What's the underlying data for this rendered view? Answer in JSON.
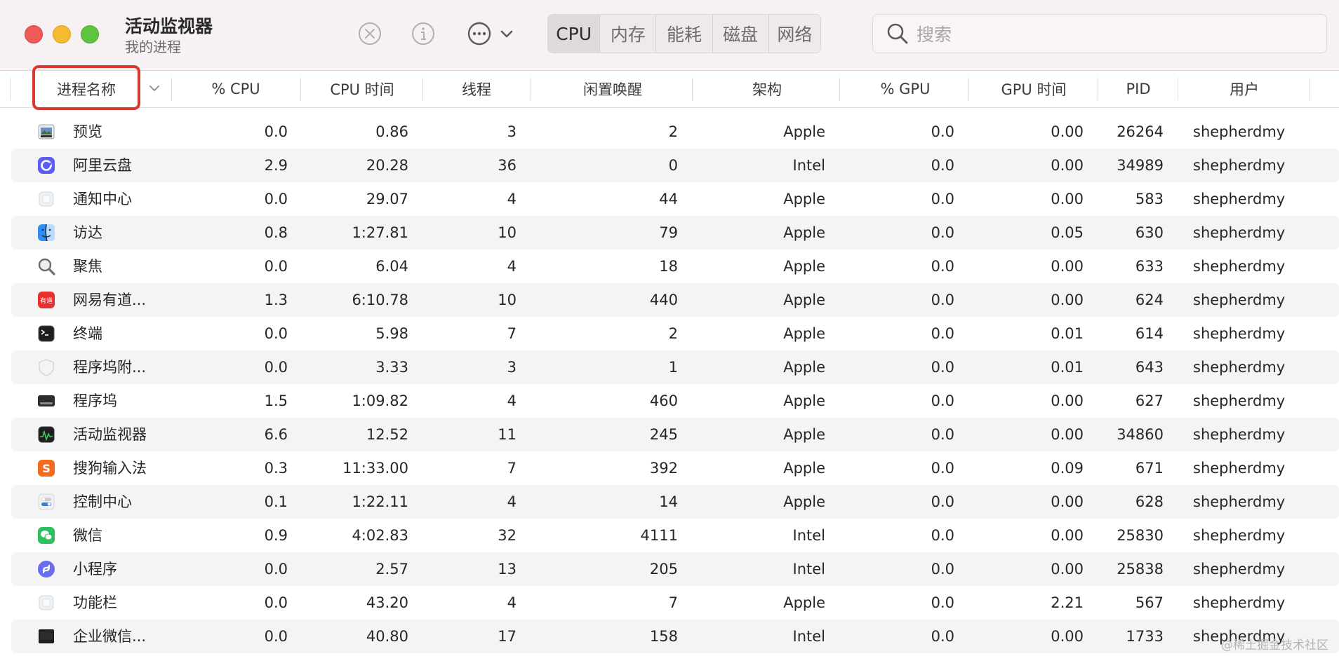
{
  "window": {
    "title": "活动监视器",
    "subtitle": "我的进程"
  },
  "toolbar": {
    "icons": [
      "stop-process-icon",
      "info-icon",
      "more-actions-icon",
      "chevron-down-icon"
    ],
    "tabs": [
      {
        "label": "CPU",
        "active": true
      },
      {
        "label": "内存",
        "active": false
      },
      {
        "label": "能耗",
        "active": false
      },
      {
        "label": "磁盘",
        "active": false
      },
      {
        "label": "网络",
        "active": false
      }
    ],
    "search": {
      "placeholder": "搜索",
      "value": ""
    }
  },
  "columns": [
    "进程名称",
    "% CPU",
    "CPU 时间",
    "线程",
    "闲置唤醒",
    "架构",
    "% GPU",
    "GPU 时间",
    "PID",
    "用户"
  ],
  "rows": [
    {
      "icon": "preview-icon",
      "name": "预览",
      "cpu": "0.0",
      "cpu_time": "0.86",
      "threads": "3",
      "idle_wakeups": "2",
      "arch": "Apple",
      "gpu": "0.0",
      "gpu_time": "0.00",
      "pid": "26264",
      "user": "shepherdmy"
    },
    {
      "icon": "aliyun-drive-icon",
      "name": "阿里云盘",
      "cpu": "2.9",
      "cpu_time": "20.28",
      "threads": "36",
      "idle_wakeups": "0",
      "arch": "Intel",
      "gpu": "0.0",
      "gpu_time": "0.00",
      "pid": "34989",
      "user": "shepherdmy"
    },
    {
      "icon": "generic-app-icon",
      "name": "通知中心",
      "cpu": "0.0",
      "cpu_time": "29.07",
      "threads": "4",
      "idle_wakeups": "44",
      "arch": "Apple",
      "gpu": "0.0",
      "gpu_time": "0.00",
      "pid": "583",
      "user": "shepherdmy"
    },
    {
      "icon": "finder-icon",
      "name": "访达",
      "cpu": "0.8",
      "cpu_time": "1:27.81",
      "threads": "10",
      "idle_wakeups": "79",
      "arch": "Apple",
      "gpu": "0.0",
      "gpu_time": "0.05",
      "pid": "630",
      "user": "shepherdmy"
    },
    {
      "icon": "spotlight-icon",
      "name": "聚焦",
      "cpu": "0.0",
      "cpu_time": "6.04",
      "threads": "4",
      "idle_wakeups": "18",
      "arch": "Apple",
      "gpu": "0.0",
      "gpu_time": "0.00",
      "pid": "633",
      "user": "shepherdmy"
    },
    {
      "icon": "youdao-icon",
      "name": "网易有道...",
      "cpu": "1.3",
      "cpu_time": "6:10.78",
      "threads": "10",
      "idle_wakeups": "440",
      "arch": "Apple",
      "gpu": "0.0",
      "gpu_time": "0.00",
      "pid": "624",
      "user": "shepherdmy"
    },
    {
      "icon": "terminal-icon",
      "name": "终端",
      "cpu": "0.0",
      "cpu_time": "5.98",
      "threads": "7",
      "idle_wakeups": "2",
      "arch": "Apple",
      "gpu": "0.0",
      "gpu_time": "0.01",
      "pid": "614",
      "user": "shepherdmy"
    },
    {
      "icon": "shield-icon",
      "name": "程序坞附...",
      "cpu": "0.0",
      "cpu_time": "3.33",
      "threads": "3",
      "idle_wakeups": "1",
      "arch": "Apple",
      "gpu": "0.0",
      "gpu_time": "0.01",
      "pid": "643",
      "user": "shepherdmy"
    },
    {
      "icon": "dock-icon",
      "name": "程序坞",
      "cpu": "1.5",
      "cpu_time": "1:09.82",
      "threads": "4",
      "idle_wakeups": "460",
      "arch": "Apple",
      "gpu": "0.0",
      "gpu_time": "0.00",
      "pid": "627",
      "user": "shepherdmy"
    },
    {
      "icon": "activity-monitor-icon",
      "name": "活动监视器",
      "cpu": "6.6",
      "cpu_time": "12.52",
      "threads": "11",
      "idle_wakeups": "245",
      "arch": "Apple",
      "gpu": "0.0",
      "gpu_time": "0.00",
      "pid": "34860",
      "user": "shepherdmy"
    },
    {
      "icon": "sogou-input-icon",
      "name": "搜狗输入法",
      "cpu": "0.3",
      "cpu_time": "11:33.00",
      "threads": "7",
      "idle_wakeups": "392",
      "arch": "Apple",
      "gpu": "0.0",
      "gpu_time": "0.09",
      "pid": "671",
      "user": "shepherdmy"
    },
    {
      "icon": "control-center-icon",
      "name": "控制中心",
      "cpu": "0.1",
      "cpu_time": "1:22.11",
      "threads": "4",
      "idle_wakeups": "14",
      "arch": "Apple",
      "gpu": "0.0",
      "gpu_time": "0.00",
      "pid": "628",
      "user": "shepherdmy"
    },
    {
      "icon": "wechat-icon",
      "name": "微信",
      "cpu": "0.9",
      "cpu_time": "4:02.83",
      "threads": "32",
      "idle_wakeups": "4111",
      "arch": "Intel",
      "gpu": "0.0",
      "gpu_time": "0.00",
      "pid": "25830",
      "user": "shepherdmy"
    },
    {
      "icon": "mini-program-icon",
      "name": "小程序",
      "cpu": "0.0",
      "cpu_time": "2.57",
      "threads": "13",
      "idle_wakeups": "205",
      "arch": "Intel",
      "gpu": "0.0",
      "gpu_time": "0.00",
      "pid": "25838",
      "user": "shepherdmy"
    },
    {
      "icon": "generic-app-icon",
      "name": "功能栏",
      "cpu": "0.0",
      "cpu_time": "43.20",
      "threads": "4",
      "idle_wakeups": "7",
      "arch": "Apple",
      "gpu": "0.0",
      "gpu_time": "2.21",
      "pid": "567",
      "user": "shepherdmy"
    },
    {
      "icon": "wecom-icon",
      "name": "企业微信...",
      "cpu": "0.0",
      "cpu_time": "40.80",
      "threads": "17",
      "idle_wakeups": "158",
      "arch": "Intel",
      "gpu": "0.0",
      "gpu_time": "0.00",
      "pid": "1733",
      "user": "shepherdmy"
    }
  ],
  "watermark": "@稀土掘金技术社区",
  "colors": {
    "highlight": "#d83a2e",
    "row_alt": "#f4f4f5"
  }
}
